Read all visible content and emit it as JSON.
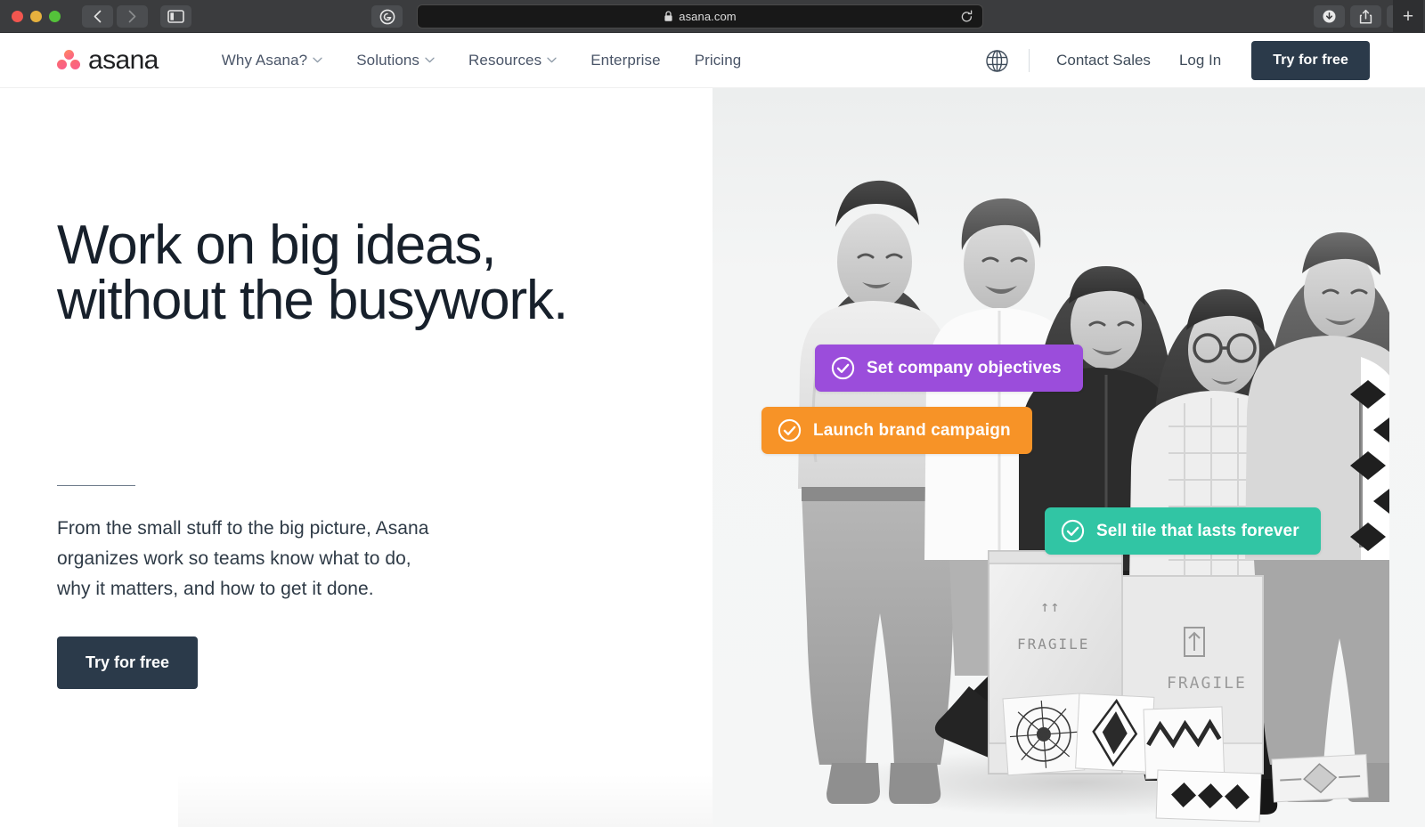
{
  "browser": {
    "url": "asana.com",
    "lock_icon": "lock-icon",
    "reload_icon": "reload-icon",
    "back_icon": "back-chevron-icon",
    "forward_icon": "forward-chevron-icon",
    "sidebar_icon": "sidebar-toggle-icon",
    "extension_icon": "grammarly-g-icon",
    "downloads_icon": "download-icon",
    "share_icon": "share-icon",
    "tabs_icon": "tab-overview-icon",
    "newtab_label": "+"
  },
  "header": {
    "brand": "asana",
    "nav": [
      {
        "label": "Why Asana?",
        "has_dropdown": true
      },
      {
        "label": "Solutions",
        "has_dropdown": true
      },
      {
        "label": "Resources",
        "has_dropdown": true
      },
      {
        "label": "Enterprise",
        "has_dropdown": false
      },
      {
        "label": "Pricing",
        "has_dropdown": false
      }
    ],
    "language_icon": "globe-icon",
    "contact_sales": "Contact Sales",
    "log_in": "Log In",
    "cta": "Try for free"
  },
  "hero": {
    "headline": "Work on big ideas,\nwithout the busywork.",
    "subcopy": "From the small stuff to the big picture, Asana\norganizes work so teams know what to do,\nwhy it matters, and how to get it done.",
    "cta": "Try for free",
    "chips": [
      {
        "label": "Set company objectives",
        "color": "#9b4ddb",
        "icon": "check-circle-icon"
      },
      {
        "label": "Launch brand campaign",
        "color": "#f79327",
        "icon": "check-circle-icon"
      },
      {
        "label": "Sell tile that lasts forever",
        "color": "#31c5a4",
        "icon": "check-circle-icon"
      }
    ]
  },
  "colors": {
    "brand_dark": "#2b3a4a",
    "headline": "#17202b",
    "nav_text": "#4a5568",
    "hero_panel_bg": "#f4f5f5",
    "chrome_bg": "#3b3c3e"
  }
}
